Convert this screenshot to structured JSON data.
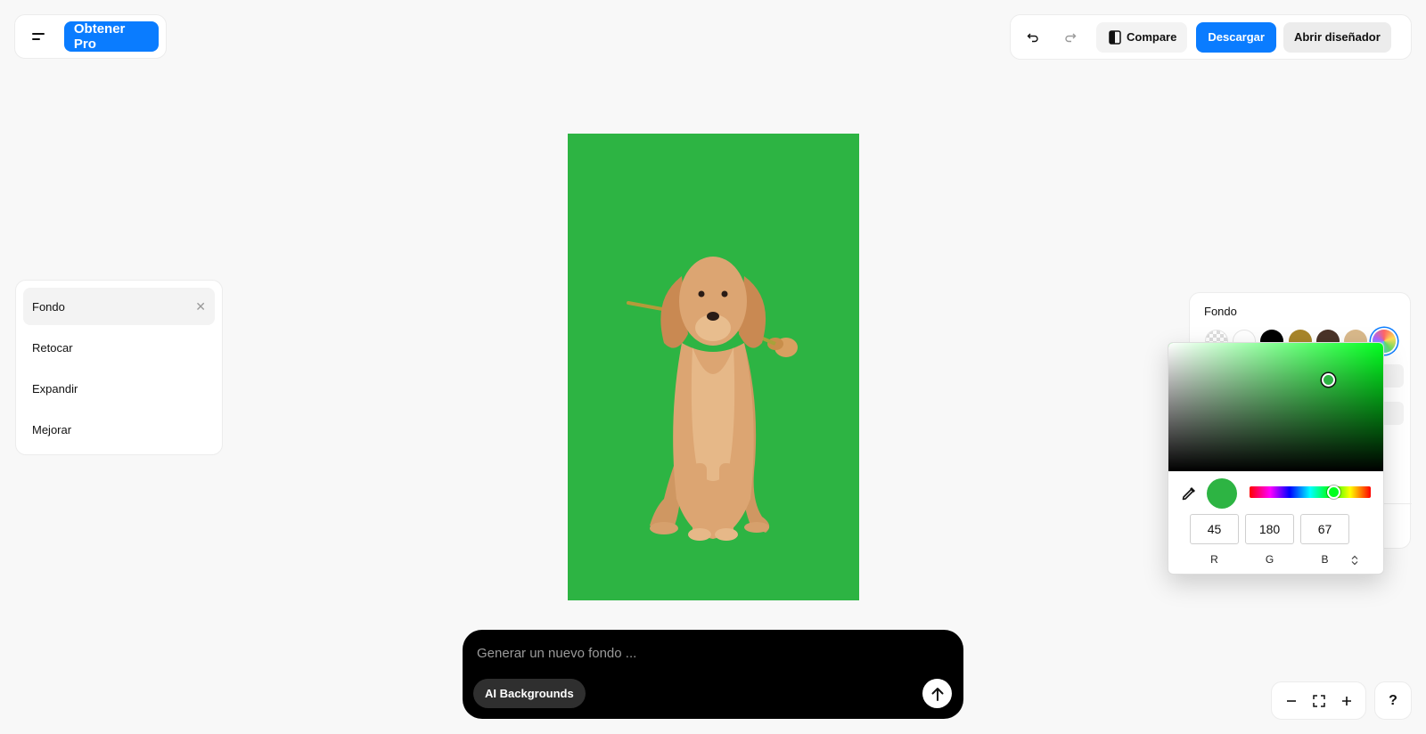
{
  "header": {
    "menu_icon": "menu-icon",
    "pro_label": "Obtener Pro",
    "undo_icon": "undo-icon",
    "redo_icon": "redo-icon",
    "compare_icon": "compare-icon",
    "compare_label": "Compare",
    "download_label": "Descargar",
    "designer_label": "Abrir diseñador"
  },
  "tools": {
    "items": [
      {
        "label": "Fondo",
        "active": true
      },
      {
        "label": "Retocar"
      },
      {
        "label": "Expandir"
      },
      {
        "label": "Mejorar"
      }
    ],
    "close_icon": "close-icon"
  },
  "canvas": {
    "background_color": "#2db443",
    "subject": "dog-with-flower"
  },
  "prompt": {
    "placeholder": "Generar un nuevo fondo ...",
    "ai_backgrounds_label": "AI Backgrounds",
    "send_icon": "arrow-up-icon"
  },
  "background_panel": {
    "title": "Fondo",
    "swatches": [
      "transparent",
      "#ffffff",
      "#000000",
      "#a8862a",
      "#4a3328",
      "#d9b98b",
      "gradient"
    ]
  },
  "color_picker": {
    "hue_color": "#00ff1e",
    "current_color": "#2db443",
    "eyedropper_icon": "eyedropper-icon",
    "r": "45",
    "g": "180",
    "b": "67",
    "r_label": "R",
    "g_label": "G",
    "b_label": "B",
    "mode_toggle_icon": "up-down-icon"
  },
  "zoom": {
    "zoom_out_icon": "minus-icon",
    "fit_icon": "fullscreen-icon",
    "zoom_in_icon": "plus-icon",
    "help_label": "?"
  }
}
